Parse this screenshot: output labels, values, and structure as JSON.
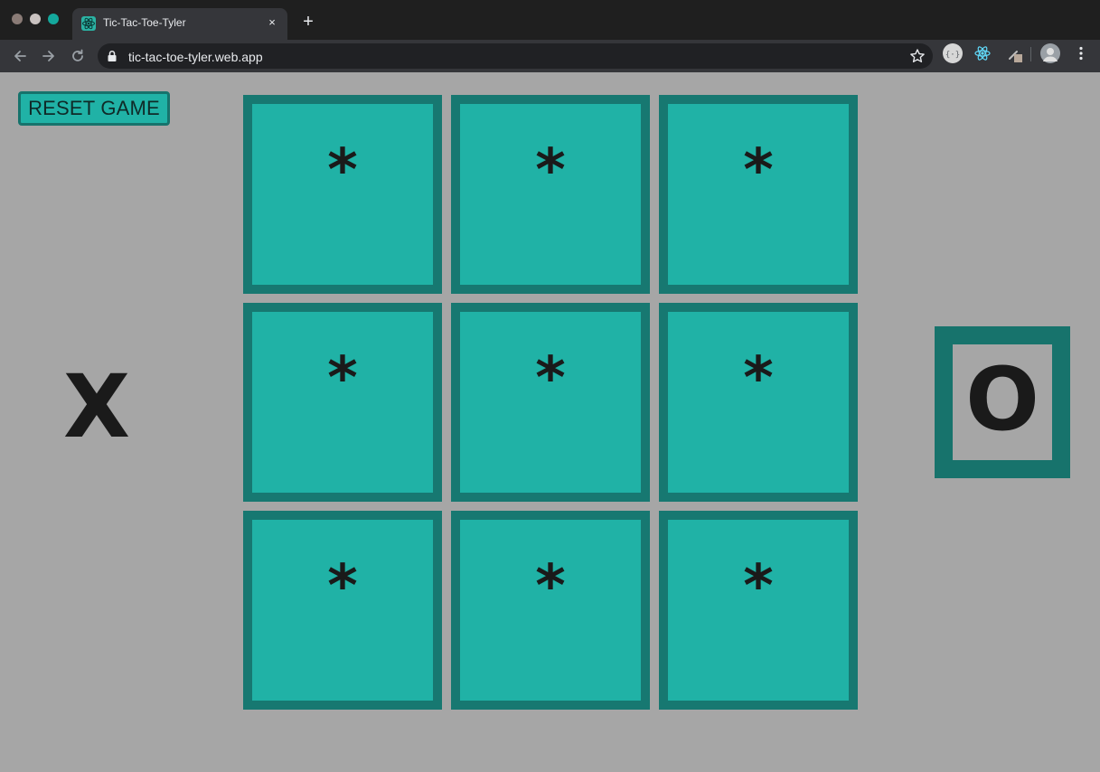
{
  "browser": {
    "tab_title": "Tic-Tac-Toe-Tyler",
    "tab_close_glyph": "×",
    "new_tab_glyph": "+",
    "url": "tic-tac-toe-tyler.web.app",
    "icons": [
      "back-arrow-icon",
      "forward-arrow-icon",
      "reload-icon",
      "lock-icon",
      "star-icon",
      "extension-icon",
      "react-devtools-icon",
      "profile-avatar",
      "kebab-menu-icon"
    ]
  },
  "game": {
    "reset_label": "RESET GAME",
    "player_x": "X",
    "player_o": "O",
    "active_player": "O",
    "board": [
      [
        "*",
        "*",
        "*"
      ],
      [
        "*",
        "*",
        "*"
      ],
      [
        "*",
        "*",
        "*"
      ]
    ]
  },
  "colors": {
    "page_background": "#a6a6a6",
    "cell_fill": "#20b2a6",
    "cell_border": "#177871",
    "mark_text": "#1a1a1a"
  }
}
